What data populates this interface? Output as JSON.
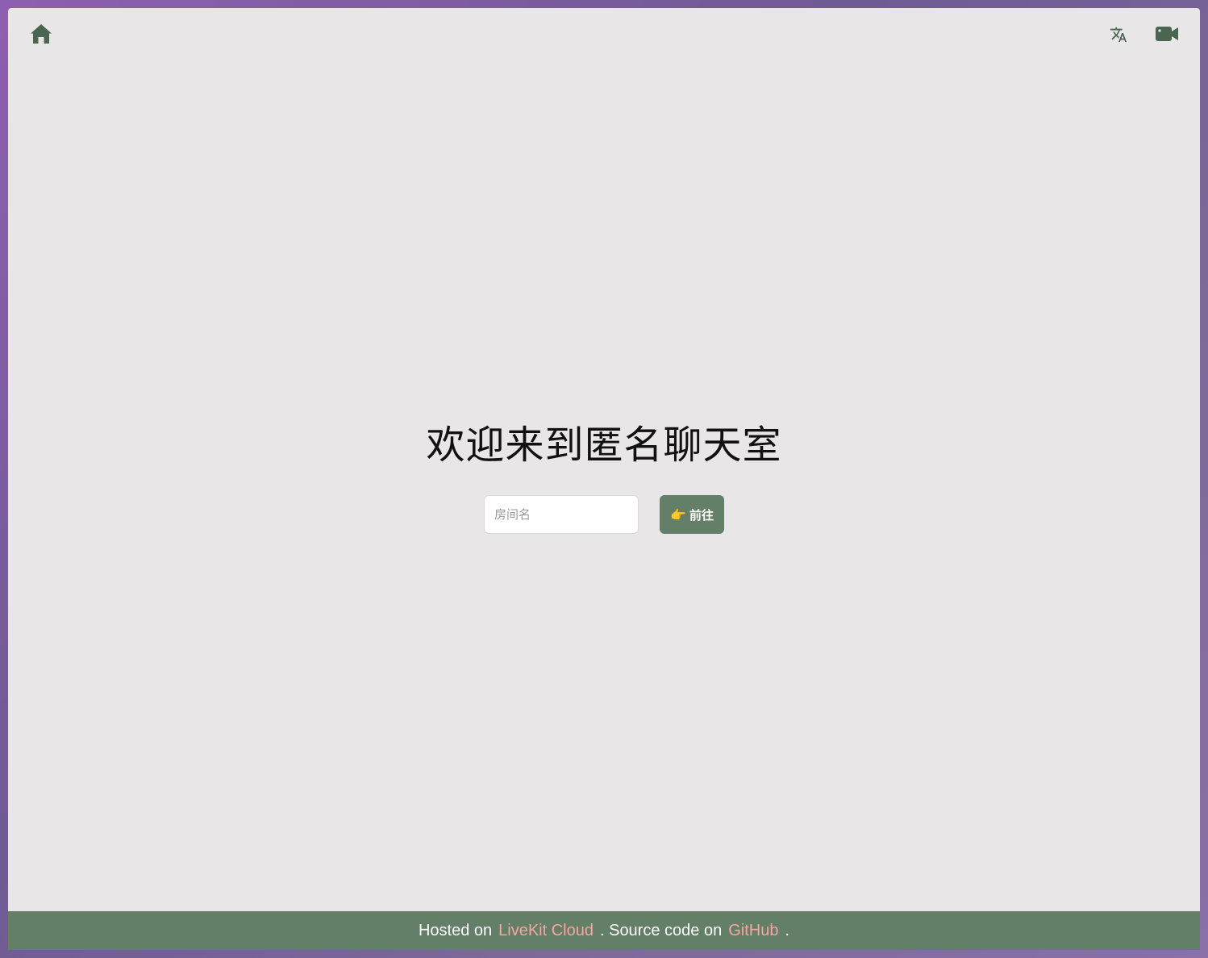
{
  "header": {
    "home_icon": "home-icon",
    "language_icon": "translate-icon",
    "video_icon": "video-camera-icon",
    "icon_color": "#4a6650"
  },
  "main": {
    "title": "欢迎来到匿名聊天室",
    "room_input": {
      "placeholder": "房间名",
      "value": ""
    },
    "go_button": {
      "icon": "👉",
      "label": "前往"
    }
  },
  "footer": {
    "text_before": "Hosted on",
    "link1": "LiveKit Cloud",
    "text_middle": ". Source code on",
    "link2": "GitHub",
    "text_after": ".",
    "background": "#637f68",
    "link_color": "#f4a6a0"
  }
}
